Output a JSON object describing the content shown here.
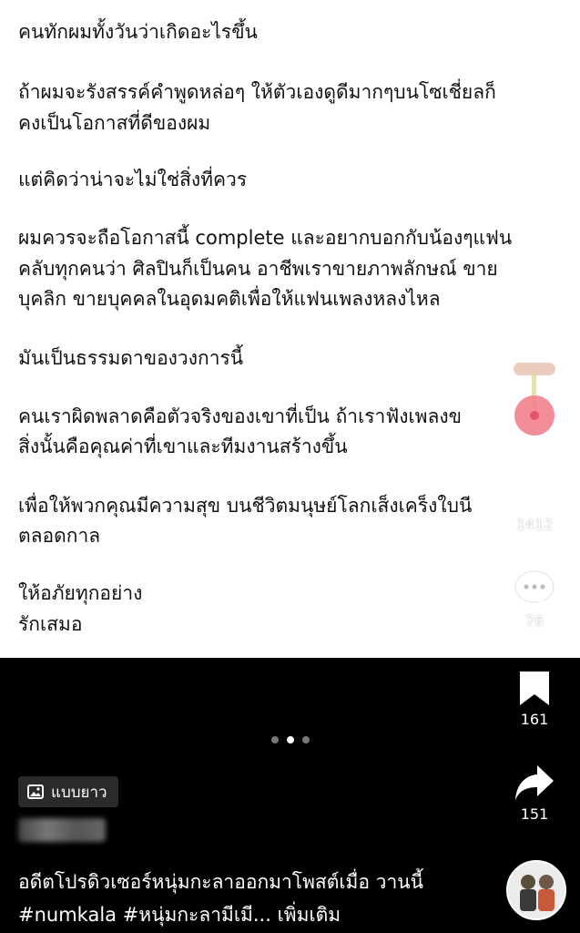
{
  "post": {
    "lines": [
      "คนทักผมทั้งวันว่าเกิดอะไรขึ้น",
      "ถ้าผมจะรังสรรค์คำพูดหล่อๆ ให้ตัวเองดูดีมากๆบนโซเชี่ยลก็",
      "คงเป็นโอกาสที่ดีของผม",
      "แต่คิดว่าน่าจะไม่ใช่สิ่งที่ควร",
      "ผมควรจะถือโอกาสนี้ complete และอยากบอกกับน้องๆแฟน",
      "คลับทุกคนว่า ศิลปินก็เป็นคน อาชีพเราขายภาพลักษณ์ ขาย",
      "บุคลิก ขายบุคคลในอุดมคติเพื่อให้แฟนเพลงหลงไหล",
      "มันเป็นธรรมดาของวงการนี้",
      "คนเราผิดพลาดคือตัวจริงของเขาที่เป็น ถ้าเราฟังเพลงข",
      "สิ่งนั้นคือคุณค่าที่เขาและทีมงานสร้างขึ้น",
      "เพื่อให้พวกคุณมีความสุข บนชีวิตมนุษย์โลกเส็งเคร็งใบนี",
      "ตลอดกาล",
      "ให้อภัยทุกอย่าง",
      "รักเสมอ"
    ]
  },
  "actions": {
    "likes": "1412",
    "comments": "76",
    "saves": "161",
    "shares": "151"
  },
  "carousel": {
    "total": 3,
    "active": 1
  },
  "badge": {
    "label": "แบบยาว",
    "icon": "image-icon"
  },
  "caption": {
    "text": "อดีตโปรดิวเซอร์หนุ่มกะลาออกมาโพสต์เมื่อ วานนี้ #numkala #หนุ่มกะลามีเมี...",
    "more": "เพิ่มเติม"
  },
  "icons": {
    "like": "heart-icon",
    "comment": "comment-icon",
    "save": "bookmark-icon",
    "share": "share-icon",
    "record": "sound-disc-icon"
  },
  "colors": {
    "background": "#000000",
    "post_bg": "#ffffff",
    "text": "#ffffff"
  }
}
